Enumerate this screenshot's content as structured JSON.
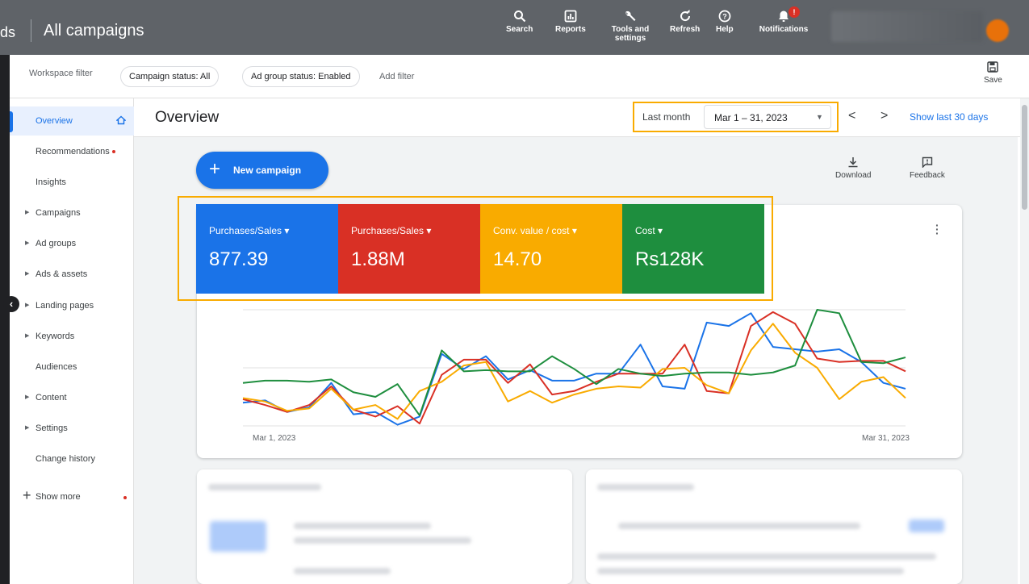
{
  "topbar": {
    "brand_fragment": "ds",
    "title": "All campaigns",
    "tools": [
      {
        "icon": "search-icon",
        "label": "Search"
      },
      {
        "icon": "reports-icon",
        "label": "Reports"
      },
      {
        "icon": "wrench-icon",
        "label": "Tools and settings"
      },
      {
        "icon": "refresh-icon",
        "label": "Refresh"
      },
      {
        "icon": "help-icon",
        "label": "Help"
      },
      {
        "icon": "bell-icon",
        "label": "Notifications",
        "badge": "!"
      }
    ]
  },
  "filters": {
    "label": "Workspace filter",
    "chips": [
      "Campaign status: All",
      "Ad group status: Enabled"
    ],
    "add_filter": "Add filter",
    "save_label": "Save"
  },
  "sidebar": {
    "items": [
      {
        "label": "Overview",
        "active": true
      },
      {
        "label": "Recommendations",
        "dot": true
      },
      {
        "label": "Insights"
      },
      {
        "label": "Campaigns",
        "expandable": true
      },
      {
        "label": "Ad groups",
        "expandable": true
      },
      {
        "label": "Ads & assets",
        "expandable": true
      },
      {
        "label": "Landing pages",
        "expandable": true
      },
      {
        "label": "Keywords",
        "expandable": true
      },
      {
        "label": "Audiences"
      },
      {
        "label": "Content",
        "expandable": true
      },
      {
        "label": "Settings",
        "expandable": true
      },
      {
        "label": "Change history"
      }
    ],
    "show_more": "Show more"
  },
  "header": {
    "title": "Overview",
    "date_label": "Last month",
    "date_range": "Mar 1 – 31, 2023",
    "show_last": "Show last 30 days"
  },
  "actions": {
    "new_campaign": "New campaign",
    "download": "Download",
    "feedback": "Feedback"
  },
  "metrics": [
    {
      "name": "Purchases/Sales",
      "value": "877.39",
      "color": "#1a73e8"
    },
    {
      "name": "Purchases/Sales",
      "value": "1.88M",
      "color": "#d93025"
    },
    {
      "name": "Conv. value / cost",
      "value": "14.70",
      "color": "#f9ab00"
    },
    {
      "name": "Cost",
      "value": "Rs128K",
      "color": "#1e8e3e"
    }
  ],
  "chart_data": {
    "type": "line",
    "x_start_label": "Mar 1, 2023",
    "x_end_label": "Mar 31, 2023",
    "x": [
      1,
      2,
      3,
      4,
      5,
      6,
      7,
      8,
      9,
      10,
      11,
      12,
      13,
      14,
      15,
      16,
      17,
      18,
      19,
      20,
      21,
      22,
      23,
      24,
      25,
      26,
      27,
      28,
      29,
      30,
      31
    ],
    "ylim": [
      0,
      100
    ],
    "grid": true,
    "series": [
      {
        "color": "#1a73e8",
        "values": [
          20,
          22,
          12,
          16,
          37,
          10,
          12,
          1,
          8,
          62,
          49,
          60,
          40,
          48,
          39,
          39,
          45,
          45,
          70,
          34,
          32,
          89,
          86,
          97,
          68,
          66,
          64,
          66,
          55,
          37,
          32
        ]
      },
      {
        "color": "#d93025",
        "values": [
          23,
          18,
          12,
          18,
          34,
          14,
          8,
          17,
          2,
          44,
          57,
          57,
          37,
          53,
          27,
          30,
          38,
          45,
          45,
          45,
          70,
          30,
          28,
          86,
          98,
          88,
          58,
          55,
          56,
          56,
          47
        ]
      },
      {
        "color": "#f9ab00",
        "values": [
          24,
          21,
          13,
          15,
          32,
          14,
          18,
          6,
          30,
          38,
          52,
          55,
          21,
          30,
          20,
          27,
          32,
          34,
          33,
          49,
          50,
          35,
          28,
          65,
          88,
          63,
          50,
          23,
          38,
          42,
          24
        ]
      },
      {
        "color": "#1e8e3e",
        "values": [
          37,
          39,
          39,
          38,
          40,
          29,
          25,
          36,
          9,
          65,
          47,
          48,
          47,
          47,
          60,
          49,
          36,
          49,
          45,
          43,
          45,
          46,
          46,
          44,
          46,
          52,
          100,
          97,
          55,
          54,
          59
        ]
      }
    ]
  }
}
